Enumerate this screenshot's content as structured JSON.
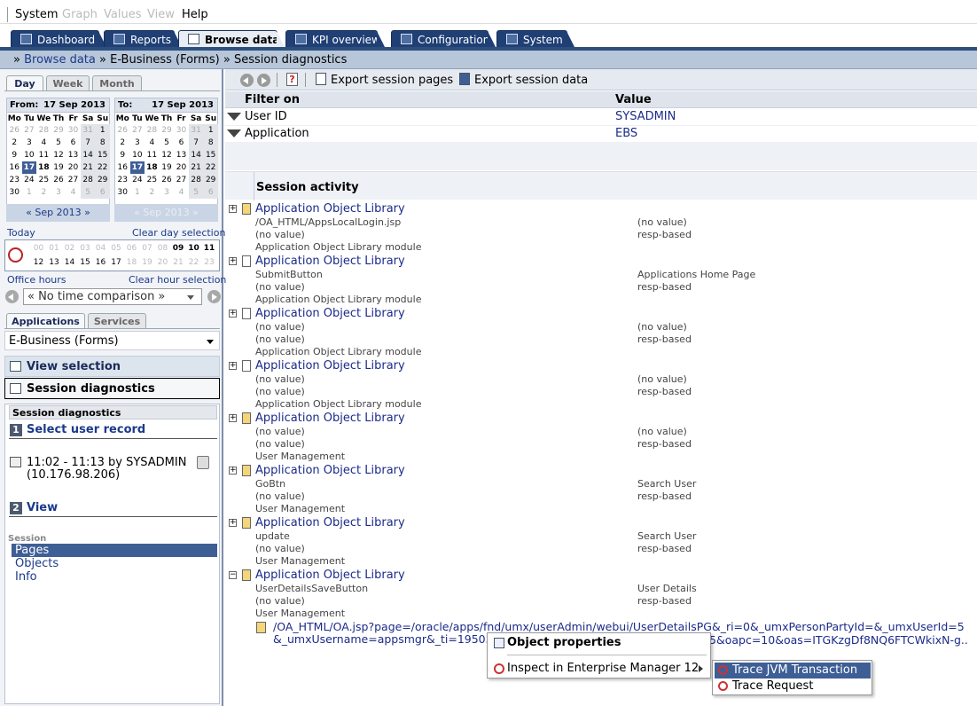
{
  "menu": {
    "items": [
      {
        "label": "System",
        "enabled": true
      },
      {
        "label": "Graph",
        "enabled": false
      },
      {
        "label": "Values",
        "enabled": false
      },
      {
        "label": "View",
        "enabled": false
      },
      {
        "label": "Help",
        "enabled": true
      }
    ]
  },
  "tabs": [
    {
      "label": "Dashboard",
      "icon": "dashboard-icon"
    },
    {
      "label": "Reports",
      "icon": "reports-icon"
    },
    {
      "label": "Browse data",
      "icon": "cube-icon",
      "active": true
    },
    {
      "label": "KPI overview",
      "icon": "gauge-icon"
    },
    {
      "label": "Configuration",
      "icon": "gear-icon"
    },
    {
      "label": "System",
      "icon": "computer-icon"
    }
  ],
  "breadcrumb": {
    "prefix": "»",
    "link": "Browse data",
    "sep1": "»",
    "part2": "E-Business (Forms)",
    "sep2": "»",
    "part3": "Session diagnostics"
  },
  "date_tabs": [
    "Day",
    "Week",
    "Month"
  ],
  "calendar_from": {
    "label": "From:",
    "date": "17 Sep 2013",
    "nav": "« Sep 2013 »"
  },
  "calendar_to": {
    "label": "To:",
    "date": "17 Sep 2013",
    "nav": "« Sep 2013 »"
  },
  "calendar_days": [
    "Mo",
    "Tu",
    "We",
    "Th",
    "Fr",
    "Sa",
    "Su"
  ],
  "calendar_weeks": [
    [
      "26",
      "27",
      "28",
      "29",
      "30",
      "31",
      "1"
    ],
    [
      "2",
      "3",
      "4",
      "5",
      "6",
      "7",
      "8"
    ],
    [
      "9",
      "10",
      "11",
      "12",
      "13",
      "14",
      "15"
    ],
    [
      "16",
      "17",
      "18",
      "19",
      "20",
      "21",
      "22"
    ],
    [
      "23",
      "24",
      "25",
      "26",
      "27",
      "28",
      "29"
    ],
    [
      "30",
      "1",
      "2",
      "3",
      "4",
      "5",
      "6"
    ]
  ],
  "time": {
    "today": "Today",
    "clear_day": "Clear day selection",
    "office_hours": "Office hours",
    "clear_hour": "Clear hour selection",
    "hours_row1": [
      "00",
      "01",
      "02",
      "03",
      "04",
      "05",
      "06",
      "07",
      "08",
      "09",
      "10",
      "11"
    ],
    "hours_row2": [
      "12",
      "13",
      "14",
      "15",
      "16",
      "17",
      "18",
      "19",
      "20",
      "21",
      "22",
      "23"
    ],
    "comparison": "« No time comparison »"
  },
  "app_tabs": [
    "Applications",
    "Services"
  ],
  "app_select": "E-Business (Forms)",
  "panels": {
    "view_selection": "View selection",
    "session_diagnostics": "Session diagnostics"
  },
  "diag": {
    "header": "Session diagnostics",
    "step1_num": "1",
    "step1": "Select user record",
    "record_line1": "11:02 - 11:13 by SYSADMIN",
    "record_line2": "(10.176.98.206)",
    "step2_num": "2",
    "step2": "View",
    "session_label": "Session",
    "nav": [
      "Pages",
      "Objects",
      "Info"
    ]
  },
  "toolbar": {
    "export_pages": "Export session pages",
    "export_data": "Export session data"
  },
  "filter": {
    "col1": "Filter on",
    "col2": "Value",
    "rows": [
      {
        "name": "User ID",
        "value": "SYSADMIN"
      },
      {
        "name": "Application",
        "value": "EBS"
      }
    ]
  },
  "activity_header": "Session activity",
  "activity": [
    {
      "title": "Application Object Library",
      "l1": "/OA_HTML/AppsLocalLogin.jsp",
      "r1": "(no value)",
      "l2": "(no value)",
      "r2": "resp-based",
      "l3": "Application Object Library module",
      "warn": true,
      "expanded": false
    },
    {
      "title": "Application Object Library",
      "l1": "SubmitButton",
      "r1": "Applications Home Page",
      "l2": "(no value)",
      "r2": "resp-based",
      "l3": "Application Object Library module",
      "warn": false,
      "expanded": false
    },
    {
      "title": "Application Object Library",
      "l1": "(no value)",
      "r1": "(no value)",
      "l2": "(no value)",
      "r2": "resp-based",
      "l3": "Application Object Library module",
      "warn": false,
      "expanded": false
    },
    {
      "title": "Application Object Library",
      "l1": "(no value)",
      "r1": "(no value)",
      "l2": "(no value)",
      "r2": "resp-based",
      "l3": "Application Object Library module",
      "warn": false,
      "expanded": false
    },
    {
      "title": "Application Object Library",
      "l1": "(no value)",
      "r1": "(no value)",
      "l2": "(no value)",
      "r2": "resp-based",
      "l3": "User Management",
      "warn": true,
      "expanded": false
    },
    {
      "title": "Application Object Library",
      "l1": "GoBtn",
      "r1": "Search User",
      "l2": "(no value)",
      "r2": "resp-based",
      "l3": "User Management",
      "warn": true,
      "expanded": false
    },
    {
      "title": "Application Object Library",
      "l1": "update",
      "r1": "Search User",
      "l2": "(no value)",
      "r2": "resp-based",
      "l3": "User Management",
      "warn": true,
      "expanded": false
    },
    {
      "title": "Application Object Library",
      "l1": "UserDetailsSaveButton",
      "r1": "User Details",
      "l2": "(no value)",
      "r2": "resp-based",
      "l3": "User Management",
      "warn": true,
      "expanded": true
    }
  ],
  "url": {
    "line1": "/OA_HTML/OA.jsp?page=/oracle/apps/fnd/umx/userAdmin/webui/UserDetailsPG&_ri=0&_umxPersonPartyId=&_umxUserId=5",
    "line2_start": "&_umxUsername=appsmgr&_ti=19505",
    "line2_end": "5&oapc=10&oas=ITGKzgDf8NQ6FTCWkixN-g.."
  },
  "context_menu": {
    "object_properties": "Object properties",
    "inspect": "Inspect in Enterprise Manager 12"
  },
  "submenu": {
    "trace_jvm": "Trace JVM Transaction",
    "trace_request": "Trace Request"
  },
  "colors": {
    "tab_bg": "#1f3f75",
    "selection": "#3e5e96",
    "link": "#1b2b8a",
    "breadcrumb_bg": "#b7c6d9"
  }
}
